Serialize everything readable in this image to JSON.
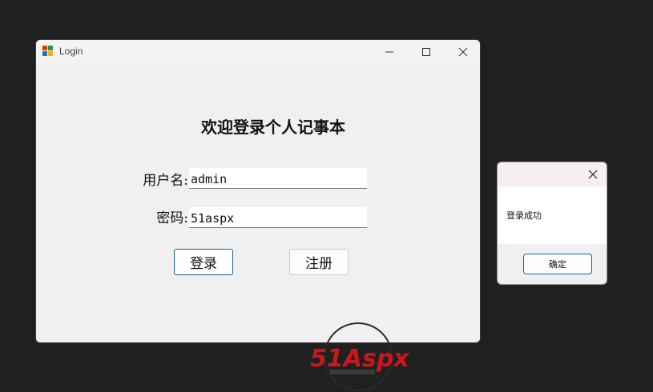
{
  "window": {
    "title": "Login",
    "minimize_icon": "minimize-icon",
    "maximize_icon": "maximize-icon",
    "close_icon": "close-icon"
  },
  "form": {
    "heading": "欢迎登录个人记事本",
    "username_label": "用户名:",
    "username_value": "admin",
    "password_label": "密码:",
    "password_value": "51aspx",
    "login_label": "登录",
    "register_label": "注册"
  },
  "dialog": {
    "message": "登录成功",
    "ok_label": "确定",
    "close_icon": "close-icon"
  },
  "watermark": {
    "text": "51Aspx",
    "colors": {
      "red": "#c8181e",
      "green": "#2f8f2f"
    }
  },
  "colors": {
    "accent": "#1a5fa3",
    "desktop": "#202020",
    "window": "#f0f0f0"
  }
}
